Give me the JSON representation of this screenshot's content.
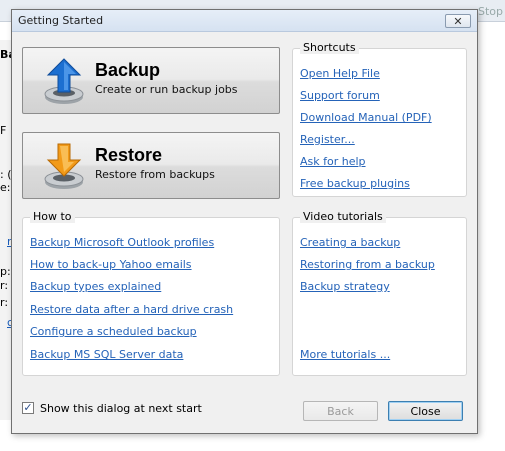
{
  "background": {
    "stop_label": "Stop",
    "left_fragments": [
      "Ba",
      "F",
      ": (",
      "e:",
      "ry",
      "p:",
      "r:",
      "r:",
      "cs"
    ]
  },
  "dialog": {
    "title": "Getting Started",
    "close_symbol": "✕",
    "backup": {
      "title": "Backup",
      "subtitle": "Create or run backup jobs"
    },
    "restore": {
      "title": "Restore",
      "subtitle": "Restore from backups"
    },
    "shortcuts": {
      "title": "Shortcuts",
      "links": [
        "Open Help File",
        "Support forum",
        "Download Manual (PDF)",
        "Register...",
        "Ask for help",
        "Free backup plugins"
      ]
    },
    "howto": {
      "title": "How to",
      "links": [
        "Backup Microsoft Outlook profiles",
        "How to back-up Yahoo emails",
        "Backup types explained",
        "Restore data after a hard drive crash",
        "Configure a scheduled backup",
        "Backup MS SQL Server data"
      ]
    },
    "video": {
      "title": "Video tutorials",
      "links": [
        "Creating a backup",
        "Restoring from a backup",
        "Backup strategy"
      ],
      "more": "More tutorials ..."
    },
    "footer": {
      "checkbox_label": "Show this dialog at next start",
      "checkbox_mark": "✓",
      "back_label": "Back",
      "close_label": "Close"
    },
    "colors": {
      "link": "#2563b8",
      "backup_arrow": "#1c6fd1",
      "restore_arrow": "#f29a18"
    }
  }
}
